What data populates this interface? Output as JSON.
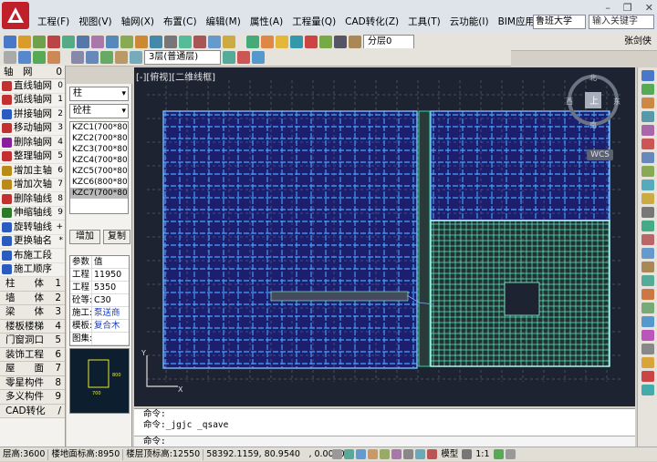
{
  "titlebar": {
    "menus": [
      "工程(F)",
      "视图(V)",
      "轴网(X)",
      "布置(C)",
      "编辑(M)",
      "属性(A)",
      "工程量(Q)",
      "CAD转化(Z)",
      "工具(T)",
      "云功能(I)",
      "BIM应用"
    ],
    "workspace_value": "鲁班大学",
    "search_placeholder": "输入关键字",
    "user": "张剑侠"
  },
  "toolbar": {
    "floor_value": "3层(普通层)",
    "layer_value": "分层0"
  },
  "left_nav": {
    "header_label": "轴　网",
    "header_count": "0",
    "items": [
      {
        "label": "直线轴网",
        "key": "0",
        "color": "#c23030"
      },
      {
        "label": "弧线轴网",
        "key": "1",
        "color": "#c23030"
      },
      {
        "label": "拼接轴网",
        "key": "2",
        "color": "#2a5bc0"
      },
      {
        "label": "移动轴网",
        "key": "3",
        "color": "#c23030"
      },
      {
        "label": "删除轴网",
        "key": "4",
        "color": "#8a1e9e"
      },
      {
        "label": "整理轴网",
        "key": "5",
        "color": "#c23030"
      },
      {
        "label": "增加主轴",
        "key": "6",
        "color": "#b98a15"
      },
      {
        "label": "增加次轴",
        "key": "7",
        "color": "#b98a15"
      },
      {
        "label": "删除轴线",
        "key": "8",
        "color": "#c23030"
      },
      {
        "label": "伸缩轴线",
        "key": "9",
        "color": "#2a7a2a"
      },
      {
        "label": "旋转轴线",
        "key": "+",
        "color": "#2a5bc0"
      },
      {
        "label": "更换轴名",
        "key": "*",
        "color": "#2a5bc0"
      },
      {
        "label": "布施工段",
        "key": "",
        "color": "#2a5bc0"
      },
      {
        "label": "施工顺序",
        "key": "",
        "color": "#2a5bc0"
      }
    ],
    "categories": [
      {
        "label": "柱　　体",
        "key": "1"
      },
      {
        "label": "墙　　体",
        "key": "2"
      },
      {
        "label": "梁　　体",
        "key": "3"
      },
      {
        "label": "楼板楼梯",
        "key": "4"
      },
      {
        "label": "门窗洞口",
        "key": "5"
      },
      {
        "label": "装饰工程",
        "key": "6"
      },
      {
        "label": "屋　　面",
        "key": "7"
      },
      {
        "label": "零星构件",
        "key": "8"
      },
      {
        "label": "多义构件",
        "key": "9"
      },
      {
        "label": "CAD转化",
        "key": "/"
      }
    ]
  },
  "mid_panel": {
    "type_value": "柱",
    "material_value": "砼柱",
    "components": [
      "KZC1(700*800",
      "KZC2(700*800",
      "KZC3(700*800",
      "KZC4(700*800",
      "KZC5(700*800",
      "KZC6(800*80",
      "KZC7(700*800"
    ],
    "add_label": "增加",
    "copy_label": "复制",
    "props_header": {
      "k": "参数",
      "v": "值"
    },
    "props": [
      {
        "k": "工程",
        "v": "11950",
        "blue": false
      },
      {
        "k": "工程",
        "v": "5350",
        "blue": false
      },
      {
        "k": "砼等:",
        "v": "C30",
        "blue": false
      },
      {
        "k": "施工:",
        "v": "泵送商",
        "blue": true
      },
      {
        "k": "模板:",
        "v": "复合木",
        "blue": true
      },
      {
        "k": "图集:",
        "v": "",
        "blue": false
      }
    ],
    "preview": {
      "dim_w": "700",
      "dim_h": "800"
    }
  },
  "canvas": {
    "view_label": "[-][俯视][二维线框]",
    "compass": {
      "north": "北",
      "south": "南",
      "east": "东",
      "west": "西",
      "center": "上"
    },
    "wcs_label": "WCS"
  },
  "command": {
    "lines": [
      "命令:",
      "命令:_jgjc _qsave",
      "命令:"
    ]
  },
  "statusbar": {
    "floor_height": "层高:3600",
    "floor_level": "楼地面标高:8950",
    "top_level": "楼层顶标高:12550",
    "coords": "58392.1159, 80.9540　, 0.0000",
    "model_label": "模型",
    "scale": "1:1"
  }
}
